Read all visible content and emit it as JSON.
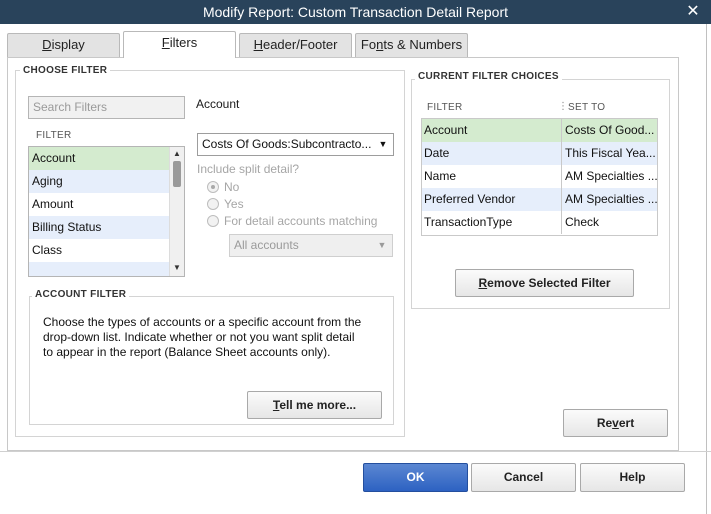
{
  "window": {
    "title": "Modify Report: Custom Transaction Detail Report",
    "close_glyph": "✕"
  },
  "tabs": [
    {
      "label": "Display",
      "hotkey": "D",
      "rest": "isplay"
    },
    {
      "label": "Filters",
      "hotkey": "F",
      "rest": "ilters"
    },
    {
      "label": "Header/Footer",
      "hotkey": "H",
      "rest": "eader/Footer"
    },
    {
      "label": "Fonts & Numbers",
      "pre": "Fo",
      "hotkey": "n",
      "rest": "ts & Numbers"
    }
  ],
  "choose_filter": {
    "title": "CHOOSE FILTER",
    "search_placeholder": "Search Filters",
    "list_header": "FILTER",
    "items": [
      "Account",
      "Aging",
      "Amount",
      "Billing Status",
      "Class"
    ],
    "selected": "Account"
  },
  "account_settings": {
    "label": "Account",
    "dropdown_value": "Costs Of Goods:Subcontracto...",
    "include_split_label": "Include split detail?",
    "radio_no": "No",
    "radio_yes": "Yes",
    "radio_matching": "For detail accounts matching",
    "matching_dropdown": "All accounts"
  },
  "account_filter": {
    "title": "ACCOUNT FILTER",
    "line1": "Choose the types of accounts or a specific account from the",
    "line2": "drop-down list. Indicate whether or not you want split detail",
    "line3": "to appear in the report (Balance Sheet accounts only).",
    "tell_me_more": {
      "hotkey": "T",
      "rest": "ell me more..."
    }
  },
  "current_filters": {
    "title": "CURRENT FILTER CHOICES",
    "col_filter": "FILTER",
    "col_set_to": "SET TO",
    "rows": [
      {
        "filter": "Account",
        "set_to": "Costs Of Good..."
      },
      {
        "filter": "Date",
        "set_to": "This Fiscal Yea..."
      },
      {
        "filter": "Name",
        "set_to": "AM Specialties ..."
      },
      {
        "filter": "Preferred Vendor",
        "set_to": "AM Specialties ..."
      },
      {
        "filter": "TransactionType",
        "set_to": "Check"
      }
    ],
    "remove_button": {
      "hotkey": "R",
      "rest": "emove Selected Filter"
    }
  },
  "buttons": {
    "revert": {
      "pre": "Re",
      "hotkey": "v",
      "rest": "ert"
    },
    "ok": "OK",
    "cancel": "Cancel",
    "help": "Help"
  },
  "colors": {
    "titlebar": "#29435b",
    "selected_row": "#d4ebcf",
    "alt_row": "#e6eefb",
    "primary_button": "#2d62c2"
  },
  "icons": {
    "close": "close-icon",
    "dropdown": "chevron-down-icon",
    "scroll_up": "scroll-up-arrow-icon",
    "scroll_down": "scroll-down-arrow-icon"
  }
}
